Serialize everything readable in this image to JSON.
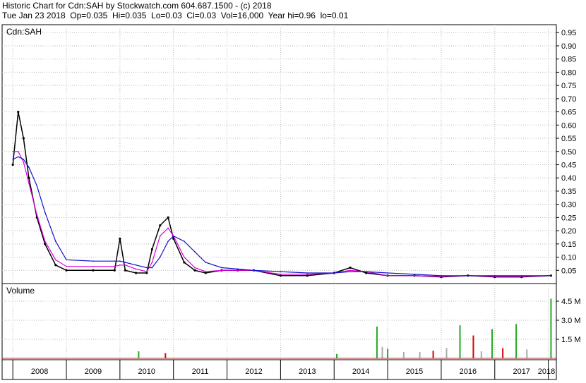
{
  "header": {
    "line1": "Historic Chart for Cdn:SAH by Stockwatch.com 604.687.1500 - (c) 2018",
    "line2": "Tue Jan 23 2018  Op=0.035  Hi=0.035  Lo=0.03  Cl=0.03  Vol=16,000  Year hi=0.96  lo=0.01"
  },
  "chart_data": [
    {
      "type": "line",
      "panel": "price",
      "title": "Cdn:SAH",
      "ylim": [
        0,
        0.98
      ],
      "yticks": [
        "0.95",
        "0.90",
        "0.85",
        "0.80",
        "0.75",
        "0.70",
        "0.65",
        "0.60",
        "0.55",
        "0.50",
        "0.45",
        "0.40",
        "0.35",
        "0.30",
        "0.25",
        "0.20",
        "0.15",
        "0.10",
        "0.05"
      ],
      "grid": true,
      "x": [
        2008.0,
        2008.1,
        2008.2,
        2008.3,
        2008.45,
        2008.6,
        2008.8,
        2009.0,
        2009.5,
        2009.9,
        2010.0,
        2010.1,
        2010.3,
        2010.5,
        2010.6,
        2010.75,
        2010.9,
        2011.0,
        2011.2,
        2011.4,
        2011.6,
        2011.9,
        2012.2,
        2012.5,
        2013.0,
        2013.5,
        2014.0,
        2014.3,
        2014.6,
        2015.0,
        2015.5,
        2016.0,
        2016.5,
        2017.0,
        2017.5,
        2018.05
      ],
      "series": [
        {
          "color": "#000000",
          "values": [
            0.45,
            0.65,
            0.55,
            0.4,
            0.25,
            0.15,
            0.07,
            0.05,
            0.05,
            0.05,
            0.17,
            0.05,
            0.04,
            0.04,
            0.13,
            0.22,
            0.25,
            0.17,
            0.08,
            0.05,
            0.04,
            0.05,
            0.05,
            0.05,
            0.03,
            0.03,
            0.04,
            0.06,
            0.04,
            0.03,
            0.03,
            0.025,
            0.03,
            0.025,
            0.025,
            0.03
          ]
        },
        {
          "color": "#dd00dd",
          "values": [
            0.5,
            0.5,
            0.46,
            0.38,
            0.26,
            0.16,
            0.09,
            0.065,
            0.065,
            0.065,
            0.07,
            0.07,
            0.055,
            0.045,
            0.08,
            0.18,
            0.21,
            0.18,
            0.1,
            0.06,
            0.045,
            0.05,
            0.05,
            0.05,
            0.035,
            0.035,
            0.04,
            0.05,
            0.045,
            0.03,
            0.03,
            0.027,
            0.03,
            0.027,
            0.027,
            0.03
          ]
        },
        {
          "color": "#1111cc",
          "values": [
            0.47,
            0.48,
            0.47,
            0.44,
            0.37,
            0.27,
            0.16,
            0.09,
            0.085,
            0.085,
            0.085,
            0.08,
            0.07,
            0.06,
            0.06,
            0.1,
            0.16,
            0.18,
            0.16,
            0.12,
            0.08,
            0.06,
            0.055,
            0.05,
            0.045,
            0.04,
            0.04,
            0.045,
            0.045,
            0.04,
            0.035,
            0.03,
            0.03,
            0.03,
            0.03,
            0.03
          ]
        }
      ]
    },
    {
      "type": "bar",
      "panel": "volume",
      "title": "Volume",
      "ylim": [
        0,
        5.0
      ],
      "yticks": [
        "4.5 M",
        "3.0 M",
        "1.5 M"
      ],
      "x": [
        2010.35,
        2010.85,
        2014.05,
        2014.8,
        2014.9,
        2015.0,
        2015.3,
        2015.6,
        2015.85,
        2016.1,
        2016.35,
        2016.6,
        2016.75,
        2016.95,
        2017.15,
        2017.4,
        2017.6,
        2018.05
      ],
      "values": [
        0.55,
        0.4,
        0.35,
        2.5,
        0.9,
        0.75,
        0.5,
        0.5,
        0.6,
        0.8,
        2.6,
        1.8,
        0.55,
        2.3,
        0.8,
        2.7,
        0.7,
        4.7
      ],
      "colors": [
        "#22aa22",
        "#dd0000",
        "#22aa22",
        "#22aa22",
        "#aaaaaa",
        "#22aa22",
        "#aaaaaa",
        "#aaaaaa",
        "#dd0000",
        "#aaaaaa",
        "#22aa22",
        "#dd0000",
        "#aaaaaa",
        "#22aa22",
        "#dd0000",
        "#22aa22",
        "#aaaaaa",
        "#22aa22"
      ]
    },
    {
      "type": "axis",
      "panel": "years",
      "labels": [
        "2008",
        "2009",
        "2010",
        "2011",
        "2012",
        "2013",
        "2014",
        "2015",
        "2016",
        "2017",
        "2018"
      ]
    }
  ]
}
